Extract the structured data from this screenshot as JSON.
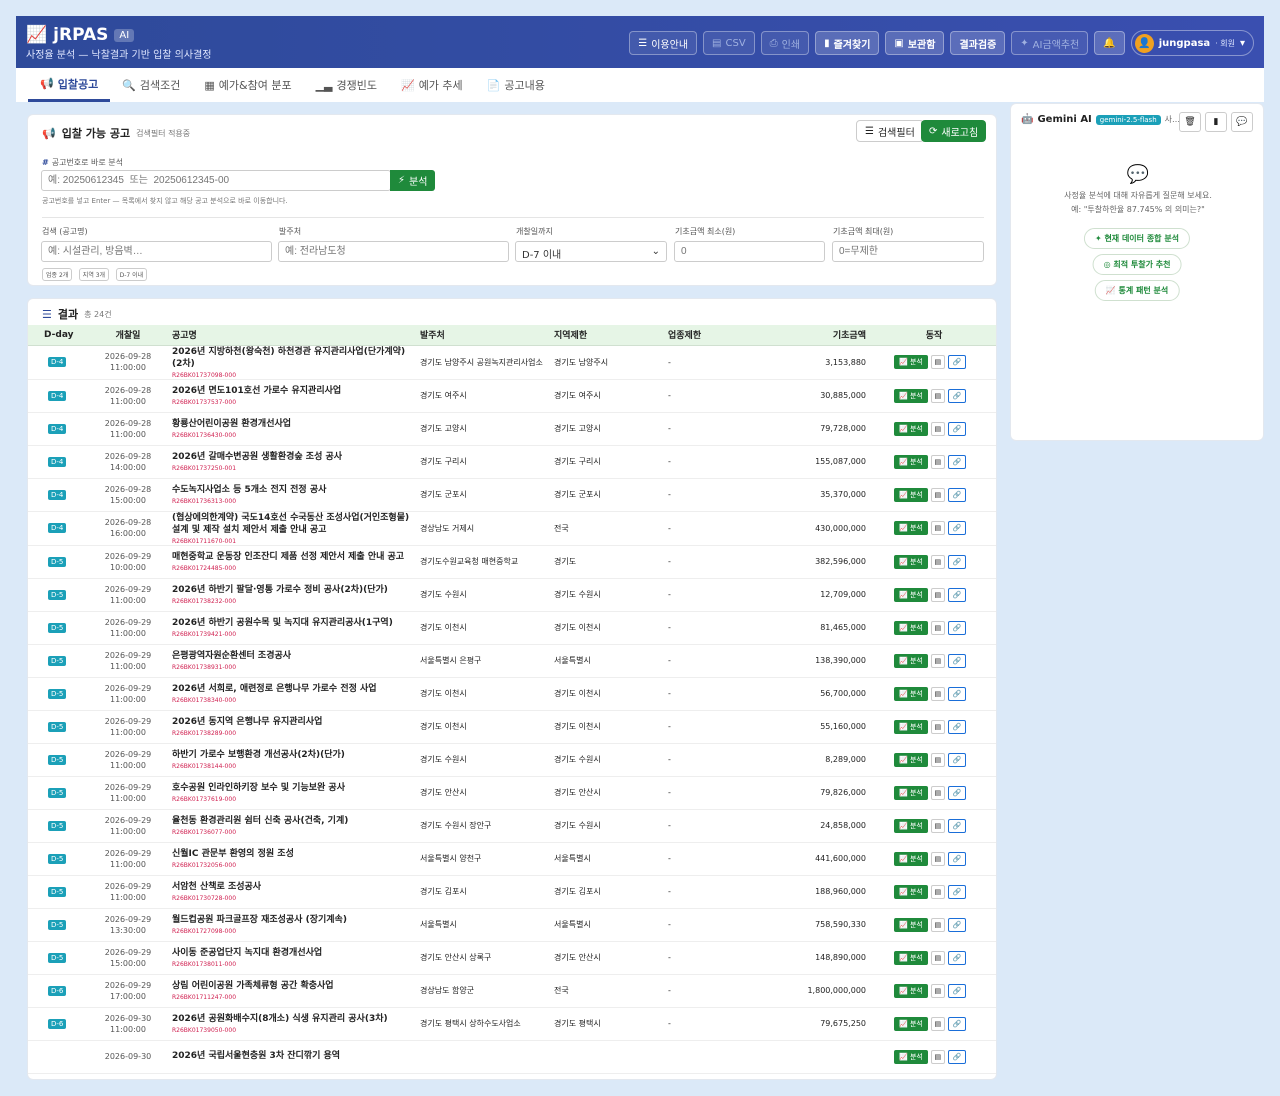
{
  "header": {
    "logo": "jRPAS",
    "ai_badge": "AI",
    "subtitle": "사정율 분석 — 낙찰결과 기반 입찰 의사결정",
    "buttons": [
      "이용안내",
      "CSV",
      "인쇄",
      "즐겨찾기",
      "보관함",
      "결과검증",
      "AI금액추천"
    ],
    "user": "jungpasa",
    "role": "· 회원"
  },
  "tabs": [
    "입찰공고",
    "검색조건",
    "예가&참여 분포",
    "경쟁빈도",
    "예가 추세",
    "공고내용"
  ],
  "filter": {
    "title": "입찰 가능 공고",
    "note": "검색필터 적용중",
    "filter_btn": "검색필터",
    "refresh_btn": "새로고침",
    "direct_label": "공고번호로 바로 분석",
    "direct_placeholder": "예: 20250612345  또는  20250612345-00",
    "analyze_btn": "분석",
    "help": "공고번호를 넣고 Enter — 목록에서 찾지 않고 해당 공고 분석으로 바로 이동합니다.",
    "labels": [
      "검색 (공고명)",
      "발주처",
      "개찰일까지",
      "기초금액 최소(원)",
      "기초금액 최대(원)"
    ],
    "placeholders": [
      "예: 시설관리, 방음벽…",
      "예: 전라남도청",
      "",
      "0",
      "0=무제한"
    ],
    "date_select": "D-7 이내",
    "chips": [
      "업종 2개",
      "지역 3개",
      "D-7 이내"
    ]
  },
  "results": {
    "title": "결과",
    "count": "총 24건",
    "columns": [
      "D-day",
      "개찰일",
      "공고명",
      "발주처",
      "지역제한",
      "업종제한",
      "기초금액",
      "동작"
    ],
    "rows": [
      {
        "dday": "D-4",
        "date": "2026-09-28",
        "time": "11:00:00",
        "name": "2026년 지방하천(왕숙천) 하천경관 유지관리사업(단가계약)(2차)",
        "id": "R26BK01737098-000",
        "org": "경기도 남양주시 공원녹지관리사업소",
        "region": "경기도 남양주시",
        "industry": "-",
        "amount": "3,153,880"
      },
      {
        "dday": "D-4",
        "date": "2026-09-28",
        "time": "11:00:00",
        "name": "2026년 면도101호선 가로수 유지관리사업",
        "id": "R26BK01737537-000",
        "org": "경기도 여주시",
        "region": "경기도 여주시",
        "industry": "-",
        "amount": "30,885,000"
      },
      {
        "dday": "D-4",
        "date": "2026-09-28",
        "time": "11:00:00",
        "name": "황룡산어린이공원 환경개선사업",
        "id": "R26BK01736430-000",
        "org": "경기도 고양시",
        "region": "경기도 고양시",
        "industry": "-",
        "amount": "79,728,000"
      },
      {
        "dday": "D-4",
        "date": "2026-09-28",
        "time": "14:00:00",
        "name": "2026년 갈매수변공원 생활환경숲 조성 공사",
        "id": "R26BK01737250-001",
        "org": "경기도 구리시",
        "region": "경기도 구리시",
        "industry": "-",
        "amount": "155,087,000"
      },
      {
        "dday": "D-4",
        "date": "2026-09-28",
        "time": "15:00:00",
        "name": "수도녹지사업소 등 5개소 전지 전정 공사",
        "id": "R26BK01736313-000",
        "org": "경기도 군포시",
        "region": "경기도 군포시",
        "industry": "-",
        "amount": "35,370,000"
      },
      {
        "dday": "D-4",
        "date": "2026-09-28",
        "time": "16:00:00",
        "name": "(협상에의한계약) 국도14호선 수국동산 조성사업(거인조형물) 설계 및 제작 설치 제안서 제출 안내 공고",
        "id": "R26BK01711670-001",
        "org": "경상남도 거제시",
        "region": "전국",
        "industry": "-",
        "amount": "430,000,000"
      },
      {
        "dday": "D-5",
        "date": "2026-09-29",
        "time": "10:00:00",
        "name": "매현중학교 운동장 인조잔디 제품 선정 제안서 제출 안내 공고",
        "id": "R26BK01724485-000",
        "org": "경기도수원교육청 매현중학교",
        "region": "경기도",
        "industry": "-",
        "amount": "382,596,000"
      },
      {
        "dday": "D-5",
        "date": "2026-09-29",
        "time": "11:00:00",
        "name": "2026년 하반기 팔달·영통 가로수 정비 공사(2차)(단가)",
        "id": "R26BK01738232-000",
        "org": "경기도 수원시",
        "region": "경기도 수원시",
        "industry": "-",
        "amount": "12,709,000"
      },
      {
        "dday": "D-5",
        "date": "2026-09-29",
        "time": "11:00:00",
        "name": "2026년 하반기 공원수목 및 녹지대 유지관리공사(1구역)",
        "id": "R26BK01739421-000",
        "org": "경기도 이천시",
        "region": "경기도 이천시",
        "industry": "-",
        "amount": "81,465,000"
      },
      {
        "dday": "D-5",
        "date": "2026-09-29",
        "time": "11:00:00",
        "name": "은평광역자원순환센터 조경공사",
        "id": "R26BK01738931-000",
        "org": "서울특별시 은평구",
        "region": "서울특별시",
        "industry": "-",
        "amount": "138,390,000"
      },
      {
        "dday": "D-5",
        "date": "2026-09-29",
        "time": "11:00:00",
        "name": "2026년 서희로, 애련정로 은행나무 가로수 전정 사업",
        "id": "R26BK01738340-000",
        "org": "경기도 이천시",
        "region": "경기도 이천시",
        "industry": "-",
        "amount": "56,700,000"
      },
      {
        "dday": "D-5",
        "date": "2026-09-29",
        "time": "11:00:00",
        "name": "2026년 동지역 은행나무 유지관리사업",
        "id": "R26BK01738289-000",
        "org": "경기도 이천시",
        "region": "경기도 이천시",
        "industry": "-",
        "amount": "55,160,000"
      },
      {
        "dday": "D-5",
        "date": "2026-09-29",
        "time": "11:00:00",
        "name": "하반기 가로수 보행환경 개선공사(2차)(단가)",
        "id": "R26BK01738144-000",
        "org": "경기도 수원시",
        "region": "경기도 수원시",
        "industry": "-",
        "amount": "8,289,000"
      },
      {
        "dday": "D-5",
        "date": "2026-09-29",
        "time": "11:00:00",
        "name": "호수공원 인라인하키장 보수 및 기능보완 공사",
        "id": "R26BK01737619-000",
        "org": "경기도 안산시",
        "region": "경기도 안산시",
        "industry": "-",
        "amount": "79,826,000"
      },
      {
        "dday": "D-5",
        "date": "2026-09-29",
        "time": "11:00:00",
        "name": "율천동 환경관리원 쉼터 신축 공사(건축, 기계)",
        "id": "R26BK01736077-000",
        "org": "경기도 수원시 장안구",
        "region": "경기도 수원시",
        "industry": "-",
        "amount": "24,858,000"
      },
      {
        "dday": "D-5",
        "date": "2026-09-29",
        "time": "11:00:00",
        "name": "신월IC 관문부 환영의 정원 조성",
        "id": "R26BK01732056-000",
        "org": "서울특별시 양천구",
        "region": "서울특별시",
        "industry": "-",
        "amount": "441,600,000"
      },
      {
        "dday": "D-5",
        "date": "2026-09-29",
        "time": "11:00:00",
        "name": "서암천 산책로 조성공사",
        "id": "R26BK01730728-000",
        "org": "경기도 김포시",
        "region": "경기도 김포시",
        "industry": "-",
        "amount": "188,960,000"
      },
      {
        "dday": "D-5",
        "date": "2026-09-29",
        "time": "13:30:00",
        "name": "월드컵공원 파크골프장 재조성공사 (장기계속)",
        "id": "R26BK01727098-000",
        "org": "서울특별시",
        "region": "서울특별시",
        "industry": "-",
        "amount": "758,590,330"
      },
      {
        "dday": "D-5",
        "date": "2026-09-29",
        "time": "15:00:00",
        "name": "사이동 준공업단지 녹지대 환경개선사업",
        "id": "R26BK01738011-000",
        "org": "경기도 안산시 상록구",
        "region": "경기도 안산시",
        "industry": "-",
        "amount": "148,890,000"
      },
      {
        "dday": "D-6",
        "date": "2026-09-29",
        "time": "17:00:00",
        "name": "상림 어린이공원 가족체류형 공간 확충사업",
        "id": "R26BK01711247-000",
        "org": "경상남도 함양군",
        "region": "전국",
        "industry": "-",
        "amount": "1,800,000,000"
      },
      {
        "dday": "D-6",
        "date": "2026-09-30",
        "time": "11:00:00",
        "name": "2026년 공원화배수지(8개소) 식생 유지관리 공사(3차)",
        "id": "R26BK01739050-000",
        "org": "경기도 평택시 상하수도사업소",
        "region": "경기도 평택시",
        "industry": "-",
        "amount": "79,675,250"
      },
      {
        "dday": "",
        "date": "2026-09-30",
        "time": "",
        "name": "2026년 국립서울현충원 3차 잔디깎기 용역",
        "id": "",
        "org": "",
        "region": "",
        "industry": "",
        "amount": ""
      }
    ],
    "action_analyze": "분석"
  },
  "gemini": {
    "title": "Gemini AI",
    "model": "gemini-2.5-flash",
    "status": "사…",
    "intro1": "사정율 분석에 대해 자유롭게 질문해 보세요.",
    "intro2": "예: \"투찰하한율 87.745% 의 의미는?\"",
    "pills": [
      "현재 데이터 종합 분석",
      "최적 투찰가 추천",
      "통계 패턴 분석"
    ]
  }
}
